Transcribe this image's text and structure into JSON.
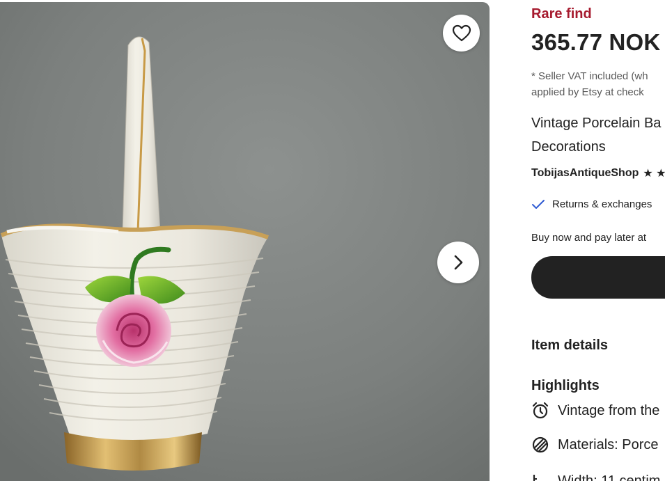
{
  "gallery": {
    "image_alt": "Vintage porcelain basket with rose decoration",
    "favorite_icon": "heart-icon",
    "next_icon": "chevron-right-icon"
  },
  "listing": {
    "badge": "Rare find",
    "price": "365.77 NOK",
    "vat_line1": "* Seller VAT included (wh",
    "vat_line2": "applied by Etsy at check",
    "title_line1": "Vintage Porcelain Ba",
    "title_line2": "Decorations",
    "shop_name": "TobijasAntiqueShop",
    "rating_stars": "★ ★",
    "returns_text": "Returns & exchanges",
    "buy_later": "Buy now and pay later at"
  },
  "details": {
    "item_details_heading": "Item details",
    "highlights_heading": "Highlights",
    "highlights": [
      {
        "icon": "alarm-clock-icon",
        "text": "Vintage from the"
      },
      {
        "icon": "materials-icon",
        "text": "Materials: Porce"
      },
      {
        "icon": "ruler-icon",
        "text": "Width: 11 centim"
      }
    ]
  },
  "colors": {
    "rare_find": "#a61a2e",
    "primary_button": "#222222",
    "check": "#2f5bd3"
  }
}
